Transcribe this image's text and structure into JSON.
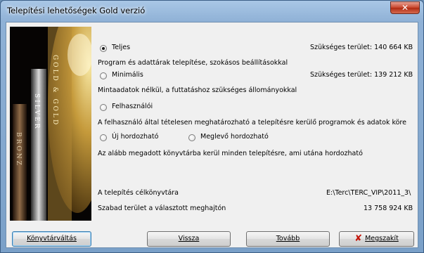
{
  "window": {
    "title": "Telepítési lehetőségek  Gold verzió",
    "close_label": "✕"
  },
  "banner": {
    "product_words": "GOLD & BRONZ & SILVER"
  },
  "options": {
    "full": {
      "label": "Teljes",
      "selected": true,
      "required_space": "Szükséges terület:  140 664 KB",
      "description": "Program és adattárak telepítése, szokásos beállításokkal"
    },
    "minimal": {
      "label": "Minimális",
      "selected": false,
      "required_space": "Szükséges terület:  139 212 KB",
      "description": "Mintaadatok nélkül, a futtatáshoz szükséges állományokkal"
    },
    "custom": {
      "label": "Felhasználói",
      "selected": false,
      "description": "A felhasználó által tételesen meghatározható a telepítésre kerülő programok és  adatok köre"
    },
    "new_portable": {
      "label": "Új hordozható",
      "selected": false
    },
    "existing_portable": {
      "label": "Meglevő hordozható",
      "selected": false
    },
    "portable_description": "Az alább megadott könyvtárba kerül minden telepítésre, ami utána hordozható"
  },
  "target": {
    "label": "A telepítés célkönyvtára",
    "value": "E:\\Terc\\TERC_VIP\\2011_3\\"
  },
  "free_space": {
    "label": "Szabad terület a választott meghajtón",
    "value": "13 758 924 KB"
  },
  "buttons": {
    "change_dir": {
      "label": "Könyvtárváltás"
    },
    "back": {
      "label": "Vissza"
    },
    "next": {
      "label": "Tovább"
    },
    "cancel": {
      "label": "Megszakít"
    }
  }
}
